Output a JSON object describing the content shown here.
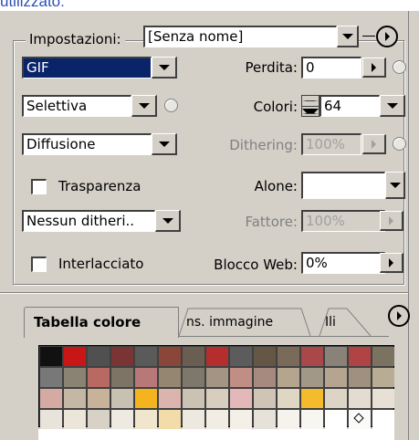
{
  "top_text": "utilizzato:",
  "settings": {
    "label": "Impostazioni:",
    "value": "[Senza nome]"
  },
  "left_column": {
    "format": "GIF",
    "palette": "Selettiva",
    "dither_algo": "Diffusione",
    "transparency_label": "Trasparenza",
    "transparency_dither": "Nessun ditheri..",
    "interlaced_label": "Interlacciato"
  },
  "right_column": {
    "lossy_label": "Perdita:",
    "lossy_value": "0",
    "colors_label": "Colori:",
    "colors_value": "64",
    "dithering_label": "Dithering:",
    "dithering_value": "100%",
    "matte_label": "Alone:",
    "matte_value": "",
    "amount_label": "Fattore:",
    "amount_value": "100%",
    "web_snap_label": "Blocco Web:",
    "web_snap_value": "0%"
  },
  "tabs": [
    {
      "label": "Tabella colore",
      "active": true
    },
    {
      "label": "ns. immagine",
      "active": false
    },
    {
      "label": "Ili",
      "active": false
    }
  ],
  "palette_colors": [
    "#111111",
    "#c81616",
    "#505050",
    "#7a3434",
    "#5a5a5a",
    "#8a4638",
    "#6a5e52",
    "#b42e2e",
    "#5c5c5c",
    "#665646",
    "#7a6a5a",
    "#a84848",
    "#8a8278",
    "#b04444",
    "#7c7260",
    "#787878",
    "#8a8272",
    "#b86a62",
    "#7e7466",
    "#b87878",
    "#948670",
    "#7e786c",
    "#a49484",
    "#c08e84",
    "#a68a80",
    "#b4a68e",
    "#a29888",
    "#b4a490",
    "#a09080",
    "#b8ac94",
    "#d4aaa2",
    "#c4b8a4",
    "#c8b29a",
    "#c8c0b0",
    "#f4b41e",
    "#dcb4ae",
    "#cac2b2",
    "#d8cebe",
    "#e4b8b8",
    "#d0c4b4",
    "#e0d6c4",
    "#f4bc2c",
    "#dcd4c4",
    "#e4dcd0",
    "#e8e0d4",
    "#e8e4dc",
    "#ece6da",
    "#d8d2c6",
    "#eeeae2",
    "#f0e6ce",
    "#f2dcaa",
    "#ede8e0",
    "#f2ede4",
    "#f4f0e8",
    "#e6e2da",
    "#f6f2ec",
    "#f8f6f0",
    "#ffffff",
    "#fafaf8",
    "#ffffff"
  ]
}
